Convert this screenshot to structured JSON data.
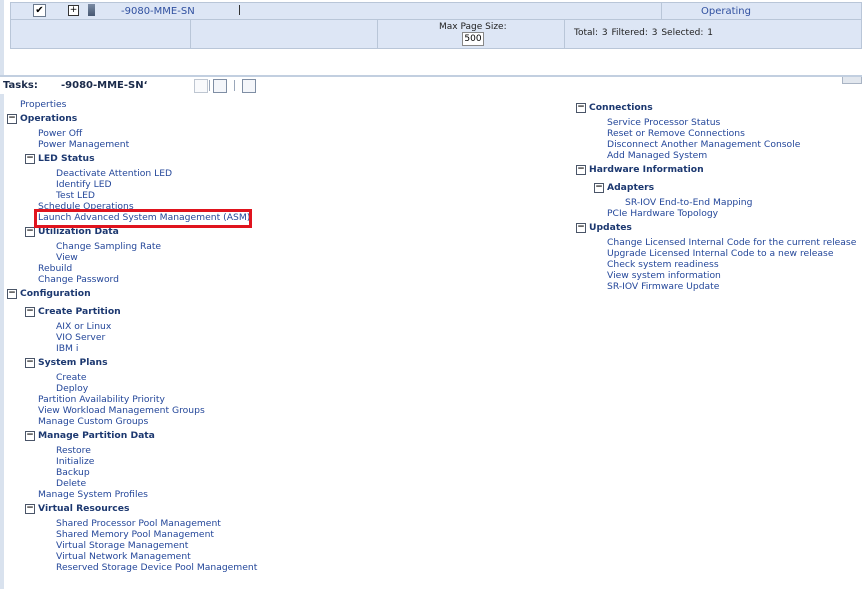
{
  "table": {
    "row": {
      "checked": "✔",
      "expand": "+",
      "name": "-9080-MME-SN",
      "status": "Operating"
    },
    "footer": {
      "max_page_label": "Max Page Size:",
      "max_page_value": "500",
      "totals": "Total: 3   Filtered: 3   Selected: 1"
    }
  },
  "tasks": {
    "label": "Tasks:",
    "name": "-9080-MME-SNʻ"
  },
  "left": {
    "properties": "Properties",
    "operations": "Operations",
    "power_off": "Power Off",
    "power_management": "Power Management",
    "led_status": "LED Status",
    "deactivate_led": "Deactivate Attention LED",
    "identify_led": "Identify LED",
    "test_led": "Test LED",
    "schedule_ops": "Schedule Operations",
    "launch_asm": "Launch Advanced System Management (ASM)",
    "utilization": "Utilization Data",
    "change_sampling": "Change Sampling Rate",
    "view": "View",
    "rebuild": "Rebuild",
    "change_password": "Change Password",
    "configuration": "Configuration",
    "create_partition": "Create Partition",
    "aix_linux": "AIX or Linux",
    "vio_server": "VIO Server",
    "ibm_i": "IBM i",
    "system_plans": "System Plans",
    "create": "Create",
    "deploy": "Deploy",
    "partition_availability": "Partition Availability Priority",
    "workload_groups": "View Workload Management Groups",
    "custom_groups": "Manage Custom Groups",
    "manage_partition_data": "Manage Partition Data",
    "restore": "Restore",
    "initialize": "Initialize",
    "backup": "Backup",
    "delete": "Delete",
    "system_profiles": "Manage System Profiles",
    "virtual_resources": "Virtual Resources",
    "shared_processor": "Shared Processor Pool Management",
    "shared_memory": "Shared Memory Pool Management",
    "virtual_storage": "Virtual Storage Management",
    "virtual_network": "Virtual Network Management",
    "reserved_storage": "Reserved Storage Device Pool Management"
  },
  "right": {
    "connections": "Connections",
    "service_processor_status": "Service Processor Status",
    "reset_remove": "Reset or Remove Connections",
    "disconnect_console": "Disconnect Another Management Console",
    "add_managed": "Add Managed System",
    "hardware_info": "Hardware Information",
    "adapters": "Adapters",
    "sriov_mapping": "SR-IOV End-to-End Mapping",
    "pcie_topology": "PCIe Hardware Topology",
    "updates": "Updates",
    "change_lic": "Change Licensed Internal Code for the current release",
    "upgrade_lic": "Upgrade Licensed Internal Code to a new release",
    "check_readiness": "Check system readiness",
    "view_sysinfo": "View system information",
    "sriov_firmware": "SR-IOV Firmware Update"
  },
  "toggle_symbol": "−",
  "colors": {
    "link": "#24479a",
    "header": "#1c3870",
    "highlight": "#e0141e",
    "table_bg": "#dde6f5"
  }
}
